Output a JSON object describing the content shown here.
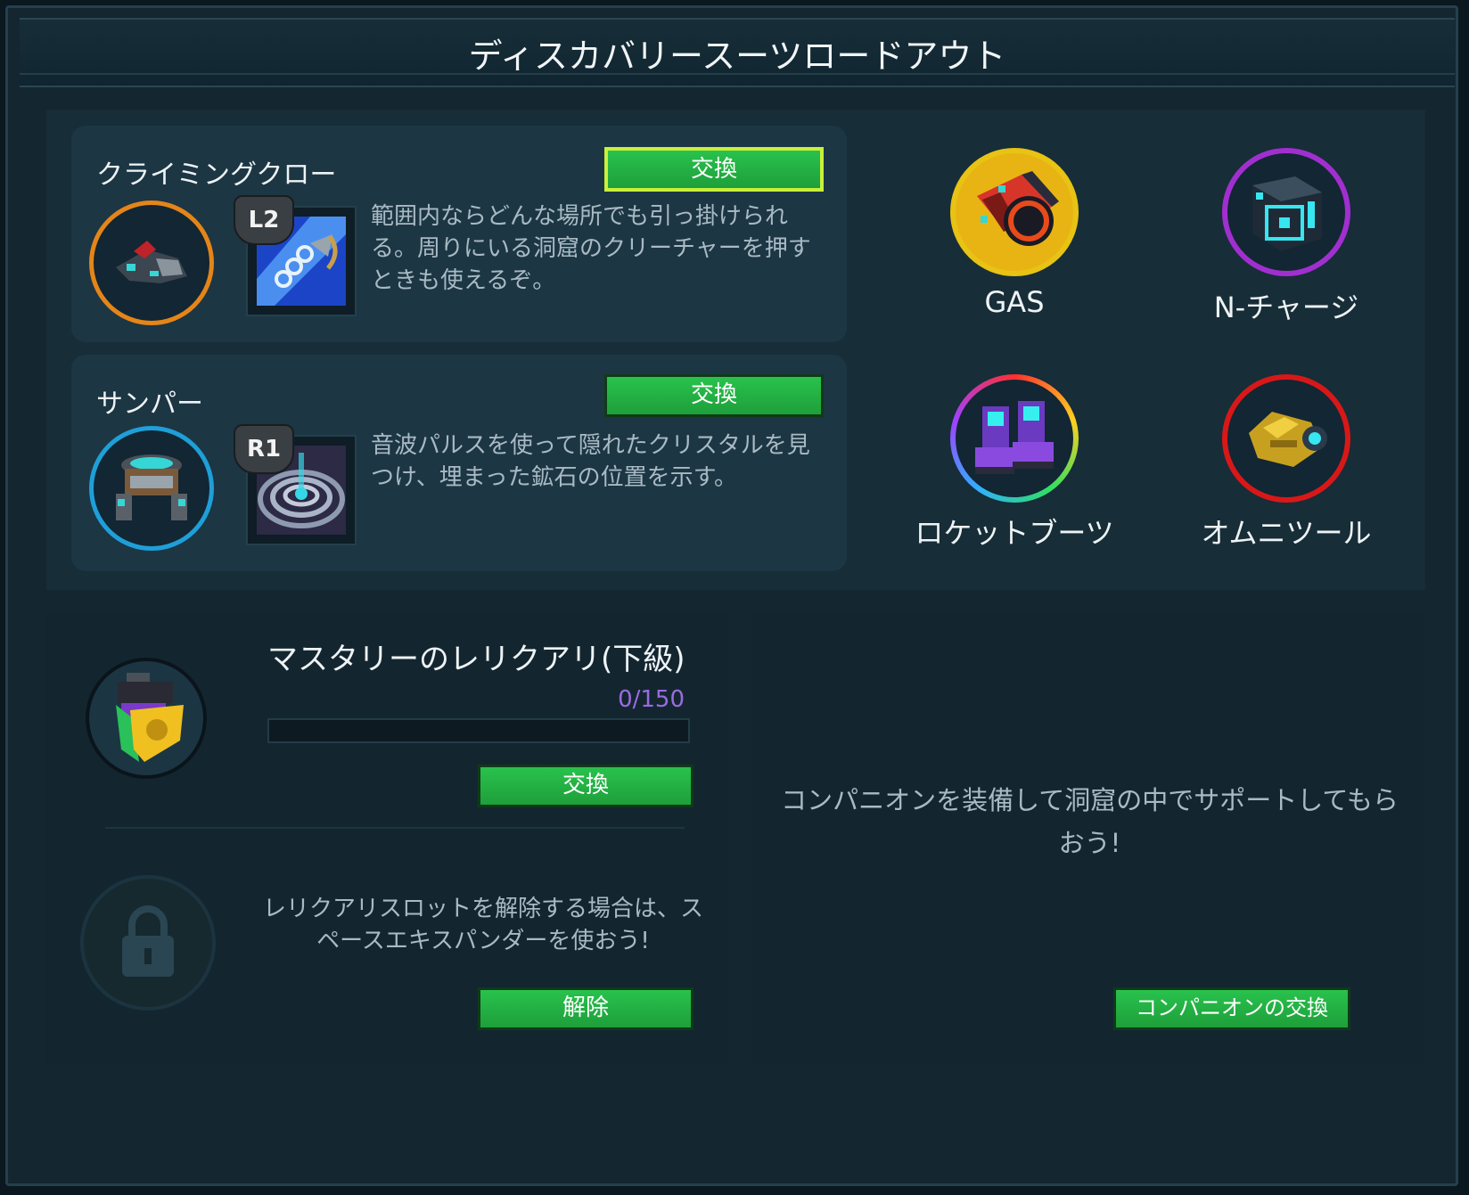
{
  "title": "ディスカバリースーツロードアウト",
  "items": [
    {
      "name": "クライミングクロー",
      "button": "交換",
      "badge": "L2",
      "description": "範囲内ならどんな場所でも引っ掛けられる。周りにいる洞窟のクリーチャーを押すときも使えるぞ。",
      "icon": "grappling-claw-icon",
      "ring_color": "#e58518",
      "selected": true
    },
    {
      "name": "サンパー",
      "button": "交換",
      "badge": "R1",
      "description": "音波パルスを使って隠れたクリスタルを見つけ、埋まった鉱石の位置を示す。",
      "icon": "thumper-icon",
      "ring_color": "#1f9fd8",
      "selected": false
    }
  ],
  "gadgets": [
    {
      "label": "GAS",
      "icon": "gas-canister-icon",
      "ring_color": "#e8c314"
    },
    {
      "label": "N-チャージ",
      "icon": "n-charge-icon",
      "ring_color": "#a12fd0"
    },
    {
      "label": "ロケットブーツ",
      "icon": "rocket-boots-icon",
      "ring_color": "rainbow"
    },
    {
      "label": "オムニツール",
      "icon": "omni-tool-icon",
      "ring_color": "#d81818"
    }
  ],
  "relic": {
    "title": "マスタリーのレリクアリ(下級)",
    "progress_text": "0/150",
    "progress_value": 0,
    "progress_max": 150,
    "button": "交換",
    "lock_text": "レリクアリスロットを解除する場合は、スペースエキスパンダーを使おう!",
    "unlock_button": "解除"
  },
  "companion": {
    "text": "コンパニオンを装備して洞窟の中でサポートしてもらおう!",
    "button": "コンパニオンの交換"
  },
  "colors": {
    "accent_green": "#29c24d",
    "selected_outline": "#c8f03a",
    "progress_text": "#9a6be0"
  }
}
